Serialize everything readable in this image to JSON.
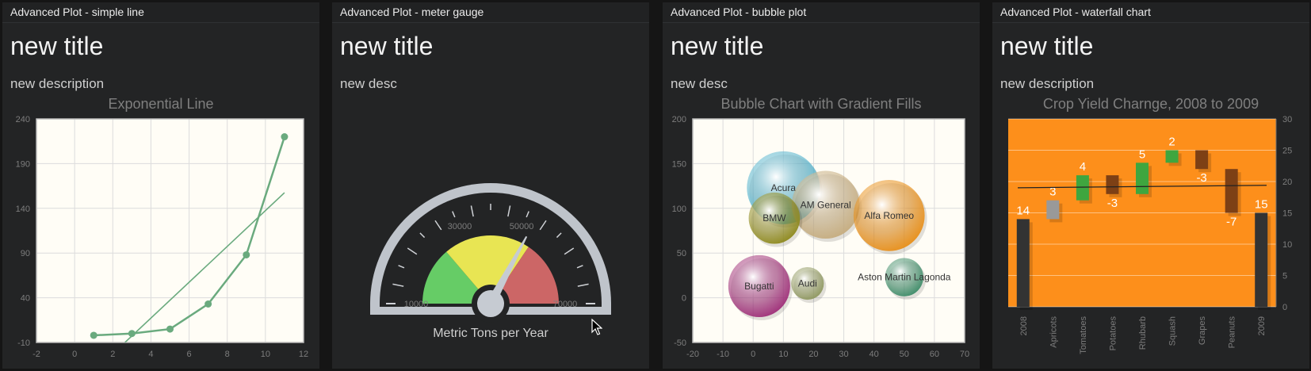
{
  "panels": [
    {
      "header": "Advanced Plot - simple line",
      "title": "new title",
      "description": "new description"
    },
    {
      "header": "Advanced Plot - meter gauge",
      "title": "new title",
      "description": "new desc"
    },
    {
      "header": "Advanced Plot - bubble plot",
      "title": "new title",
      "description": "new desc"
    },
    {
      "header": "Advanced Plot - waterfall chart",
      "title": "new title",
      "description": "new description"
    }
  ],
  "colors": {
    "line": "#6aaa7e",
    "gauge_green": "#66cc66",
    "gauge_yellow": "#e8e553",
    "gauge_red": "#cc6666",
    "waterfall_bg": "#fd8f1b",
    "waterfall_increase": "#3fa63f",
    "waterfall_decrease": "#7d4015",
    "waterfall_total": "#333333",
    "waterfall_first": "#999999"
  },
  "chart_data": [
    {
      "type": "line",
      "title": "Exponential Line",
      "x": [
        1,
        3,
        5,
        7,
        9,
        11
      ],
      "y": [
        -2,
        0,
        5,
        33,
        88,
        220
      ],
      "trendline": true,
      "xlim": [
        -2,
        12
      ],
      "ylim": [
        -10,
        240
      ],
      "xticks": [
        "-2",
        "0",
        "2",
        "4",
        "6",
        "8",
        "10",
        "12"
      ],
      "yticks": [
        "-10",
        "40",
        "90",
        "140",
        "190",
        "240"
      ],
      "grid": true
    },
    {
      "type": "gauge",
      "label": "Metric Tons per Year",
      "min": 0,
      "max": 80000,
      "value": 52500,
      "ticks": [
        "10000",
        "30000",
        "50000",
        "70000"
      ],
      "intervals": [
        22000,
        55000,
        80000
      ]
    },
    {
      "type": "scatter",
      "title": "Bubble Chart with Gradient Fills",
      "xlim": [
        -20,
        70
      ],
      "ylim": [
        -50,
        200
      ],
      "xticks": [
        "-20",
        "-10",
        "0",
        "10",
        "20",
        "30",
        "40",
        "50",
        "60",
        "70"
      ],
      "yticks": [
        "-50",
        "0",
        "50",
        "100",
        "150",
        "200"
      ],
      "grid": true,
      "points": [
        {
          "label": "Acura",
          "x": 10,
          "y": 123,
          "size": 1236
        },
        {
          "label": "AM General",
          "x": 24,
          "y": 104,
          "size": 1067
        },
        {
          "label": "Alfa Romeo",
          "x": 45,
          "y": 92,
          "size": 1176
        },
        {
          "label": "BMW",
          "x": 7,
          "y": 89,
          "size": 610
        },
        {
          "label": "Aston Martin Lagonda",
          "x": 50,
          "y": 23,
          "size": 340
        },
        {
          "label": "Bugatti",
          "x": 2,
          "y": 13,
          "size": 889
        },
        {
          "label": "Audi",
          "x": 18,
          "y": 16,
          "size": 247
        }
      ]
    },
    {
      "type": "bar",
      "subtype": "waterfall",
      "title": "Crop Yield Charnge, 2008 to 2009",
      "categories": [
        "2008",
        "Apricots",
        "Tomatoes",
        "Potatoes",
        "Rhubarb",
        "Squash",
        "Grapes",
        "Peanuts",
        "2009"
      ],
      "values": [
        14,
        3,
        4,
        -3,
        5,
        2,
        -3,
        -7,
        15
      ],
      "labels": [
        "14",
        "3",
        "4",
        "-3",
        "5",
        "2",
        "-3",
        "-7",
        "15"
      ],
      "ylim": [
        0,
        30
      ],
      "yticks": [
        "0",
        "5",
        "10",
        "15",
        "20",
        "25",
        "30"
      ],
      "trend": [
        19.0,
        19.4
      ]
    }
  ]
}
